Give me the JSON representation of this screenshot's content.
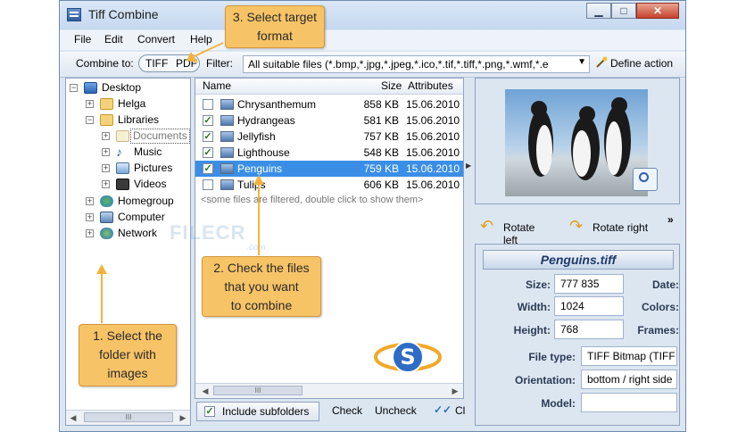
{
  "window": {
    "title": "Tiff Combine",
    "minimize": "▁",
    "maximize": "□",
    "close": "✕"
  },
  "menu": [
    "File",
    "Edit",
    "Convert",
    "Help"
  ],
  "toolbar": {
    "combine_label": "Combine to:",
    "format_tiff": "TIFF",
    "format_pdf": "PDF",
    "filter_label": "Filter:",
    "filter_value": "All suitable files (*.bmp,*.jpg,*.jpeg,*.ico,*.tif,*.tiff,*.png,*.wmf,*.e",
    "define_action": "Define action"
  },
  "tree": [
    {
      "label": "Desktop",
      "icon": "desktop-icon"
    },
    {
      "label": "Helga",
      "icon": "folder-icon"
    },
    {
      "label": "Libraries",
      "icon": "folder-icon"
    },
    {
      "label": "Documents",
      "icon": "folder-icon"
    },
    {
      "label": "Music",
      "icon": "music-icon"
    },
    {
      "label": "Pictures",
      "icon": "pictures-icon"
    },
    {
      "label": "Videos",
      "icon": "videos-icon"
    },
    {
      "label": "Homegroup",
      "icon": "homegroup-icon"
    },
    {
      "label": "Computer",
      "icon": "computer-icon"
    },
    {
      "label": "Network",
      "icon": "network-icon"
    }
  ],
  "file_list": {
    "headers": {
      "name": "Name",
      "size": "Size",
      "attributes": "Attributes"
    },
    "rows": [
      {
        "name": "Chrysanthemum",
        "size": "858 KB",
        "date": "15.06.2010",
        "checked": false,
        "selected": false
      },
      {
        "name": "Hydrangeas",
        "size": "581 KB",
        "date": "15.06.2010",
        "checked": true,
        "selected": false
      },
      {
        "name": "Jellyfish",
        "size": "757 KB",
        "date": "15.06.2010",
        "checked": true,
        "selected": false
      },
      {
        "name": "Lighthouse",
        "size": "548 KB",
        "date": "15.06.2010",
        "checked": true,
        "selected": false
      },
      {
        "name": "Penguins",
        "size": "759 KB",
        "date": "15.06.2010",
        "checked": true,
        "selected": true
      },
      {
        "name": "Tulips",
        "size": "606 KB",
        "date": "15.06.2010",
        "checked": false,
        "selected": false
      }
    ],
    "filtered_note": "<some files are filtered, double click to show them>",
    "scroll_mark": "III"
  },
  "bottom_bar": {
    "include_subfolders": "Include subfolders",
    "check": "Check",
    "uncheck": "Uncheck",
    "cl": "Cl"
  },
  "preview": {
    "rotate_left": "Rotate left",
    "rotate_right": "Rotate right",
    "more": "»"
  },
  "info": {
    "filename": "Penguins.tiff",
    "size_label": "Size:",
    "size_value": "777 835",
    "date_label": "Date:",
    "width_label": "Width:",
    "width_value": "1024",
    "colors_label": "Colors:",
    "height_label": "Height:",
    "height_value": "768",
    "frames_label": "Frames:",
    "filetype_label": "File type:",
    "filetype_value": "TIFF Bitmap (TIFF",
    "orientation_label": "Orientation:",
    "orientation_value": "bottom / right side",
    "model_label": "Model:"
  },
  "tree_scroll_mark": "III",
  "callouts": {
    "c1": [
      "1. Select the",
      "folder with",
      "images"
    ],
    "c2": [
      "2. Check the files",
      "that you want",
      "to combine"
    ],
    "c3": [
      "3. Select target",
      "format"
    ]
  },
  "watermark": {
    "text": "FILECR",
    "sub": ".com"
  },
  "colors": {
    "accent": "#f7c367",
    "selection": "#3a8ee6",
    "window_bg": "#dce6f1"
  }
}
